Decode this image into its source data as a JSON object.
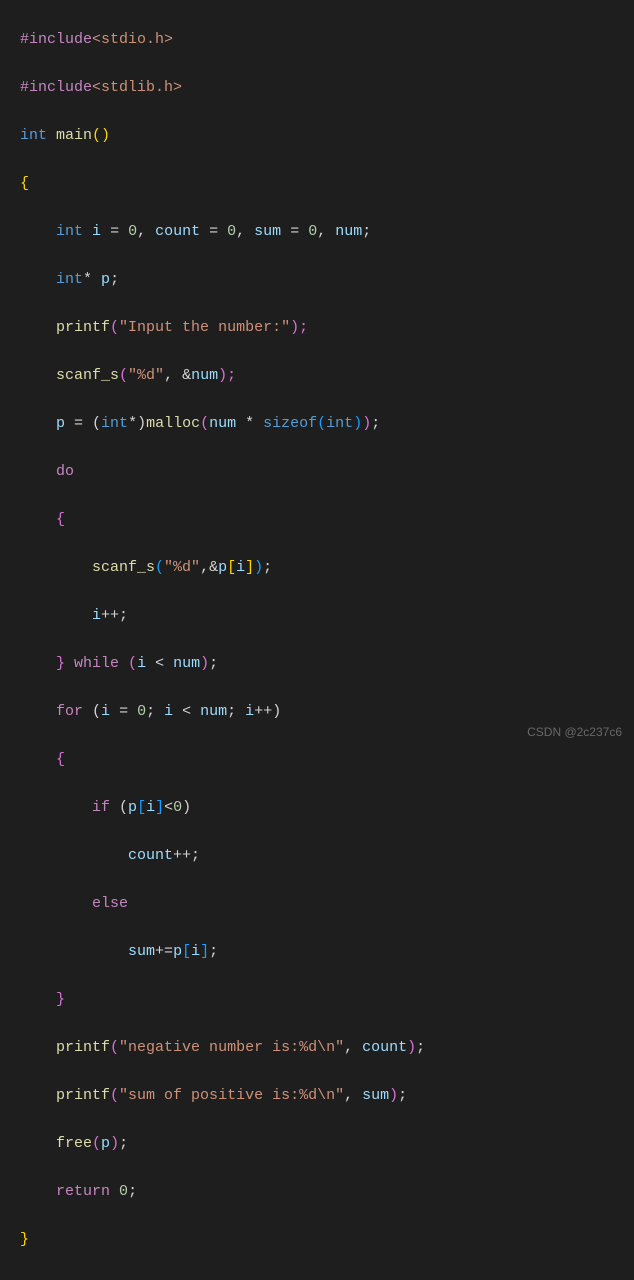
{
  "code": {
    "l1_include": "#include",
    "l1_hdr": "<stdio.h>",
    "l2_include": "#include",
    "l2_hdr": "<stdlib.h>",
    "l3_int": "int",
    "l3_main": "main",
    "l3_parens": "()",
    "l4_brace": "{",
    "l5_int": "int",
    "l5_i": "i",
    "l5_eq1": " = ",
    "l5_z1": "0",
    "l5_c1": ", ",
    "l5_count": "count",
    "l5_eq2": " = ",
    "l5_z2": "0",
    "l5_c2": ", ",
    "l5_sum": "sum",
    "l5_eq3": " = ",
    "l5_z3": "0",
    "l5_c3": ", ",
    "l5_num": "num",
    "l5_semi": ";",
    "l6_int": "int",
    "l6_star": "* ",
    "l6_p": "p",
    "l6_semi": ";",
    "l7_printf": "printf",
    "l7_str": "\"Input the number:\"",
    "l7_close": ");",
    "l8_scanf": "scanf_s",
    "l8_str": "\"%d\"",
    "l8_amp": ", &",
    "l8_num": "num",
    "l8_close": ");",
    "l9_p": "p",
    "l9_eq": " = (",
    "l9_int": "int",
    "l9_sc": "*)",
    "l9_malloc": "malloc",
    "l9_op": "(",
    "l9_num": "num",
    "l9_mul": " * ",
    "l9_sizeof": "sizeof",
    "l9_op2": "(",
    "l9_int2": "int",
    "l9_cp": "));",
    "l10_do": "do",
    "l11_brace": "{",
    "l12_scanf": "scanf_s",
    "l12_str": "\"%d\"",
    "l12_com": ",&",
    "l12_p": "p",
    "l12_ob": "[",
    "l12_i": "i",
    "l12_cb": "]);",
    "l13_i": "i",
    "l13_inc": "++;",
    "l14_brace": "}",
    "l14_while": " while ",
    "l14_op": "(",
    "l14_i": "i",
    "l14_lt": " < ",
    "l14_num": "num",
    "l14_cp": ");",
    "l15_for": "for",
    "l15_op": " (",
    "l15_i1": "i",
    "l15_eq": " = ",
    "l15_z": "0",
    "l15_s1": "; ",
    "l15_i2": "i",
    "l15_lt": " < ",
    "l15_num": "num",
    "l15_s2": "; ",
    "l15_i3": "i",
    "l15_inc": "++)",
    "l16_brace": "{",
    "l17_if": "if",
    "l17_op": " (",
    "l17_p": "p",
    "l17_ob": "[",
    "l17_i": "i",
    "l17_cb": "]<",
    "l17_z": "0",
    "l17_cp": ")",
    "l18_count": "count",
    "l18_inc": "++;",
    "l19_else": "else",
    "l20_sum": "sum",
    "l20_pe": "+=",
    "l20_p": "p",
    "l20_ob": "[",
    "l20_i": "i",
    "l20_cb": "];",
    "l21_brace": "}",
    "l22_printf": "printf",
    "l22_str": "\"negative number is:%d\\n\"",
    "l22_com": ", ",
    "l22_count": "count",
    "l22_cp": ");",
    "l23_printf": "printf",
    "l23_str": "\"sum of positive is:%d\\n\"",
    "l23_com": ", ",
    "l23_sum": "sum",
    "l23_cp": ");",
    "l24_free": "free",
    "l24_op": "(",
    "l24_p": "p",
    "l24_cp": ");",
    "l25_return": "return",
    "l25_sp": " ",
    "l25_z": "0",
    "l25_semi": ";",
    "l26_brace": "}"
  },
  "watermark": "CSDN @2c237c6"
}
